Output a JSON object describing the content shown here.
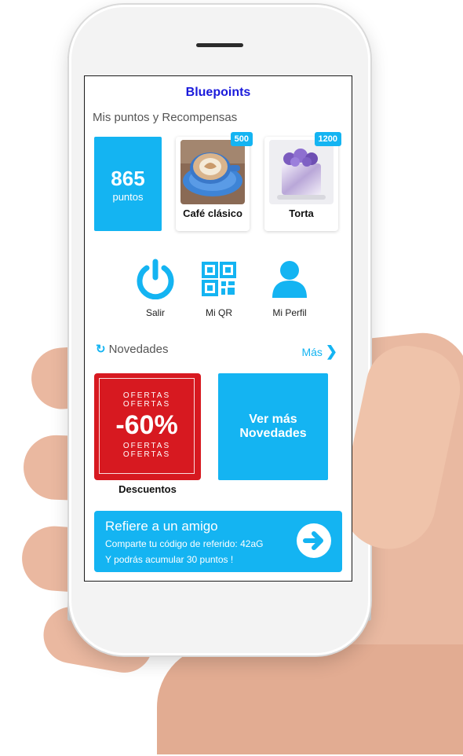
{
  "app": {
    "title": "Bluepoints",
    "subtitle": "Mis puntos y Recompensas"
  },
  "points": {
    "value": "865",
    "label": "puntos"
  },
  "rewards": [
    {
      "name": "Café clásico",
      "cost": "500",
      "image_icon": "coffee-cup-icon"
    },
    {
      "name": "Torta",
      "cost": "1200",
      "image_icon": "cake-icon"
    }
  ],
  "actions": [
    {
      "label": "Salir",
      "icon": "power-icon"
    },
    {
      "label": "Mi QR",
      "icon": "qr-code-icon"
    },
    {
      "label": "Mi Perfil",
      "icon": "user-icon"
    }
  ],
  "news": {
    "header": "Novedades",
    "more_label": "Más",
    "promo": {
      "line1": "OFERTAS",
      "line2": "OFERTAS",
      "discount": "-60%",
      "line3": "OFERTAS",
      "line4": "OFERTAS",
      "caption": "Descuentos"
    },
    "more_card_line1": "Ver más",
    "more_card_line2": "Novedades"
  },
  "referral": {
    "title": "Refiere a un amigo",
    "line1": "Comparte tu código de referido: 42aG",
    "line2": "Y podrás acumular 30 puntos !"
  },
  "colors": {
    "accent": "#14b4f2",
    "title": "#1a1adb",
    "promo_red": "#d71920"
  }
}
